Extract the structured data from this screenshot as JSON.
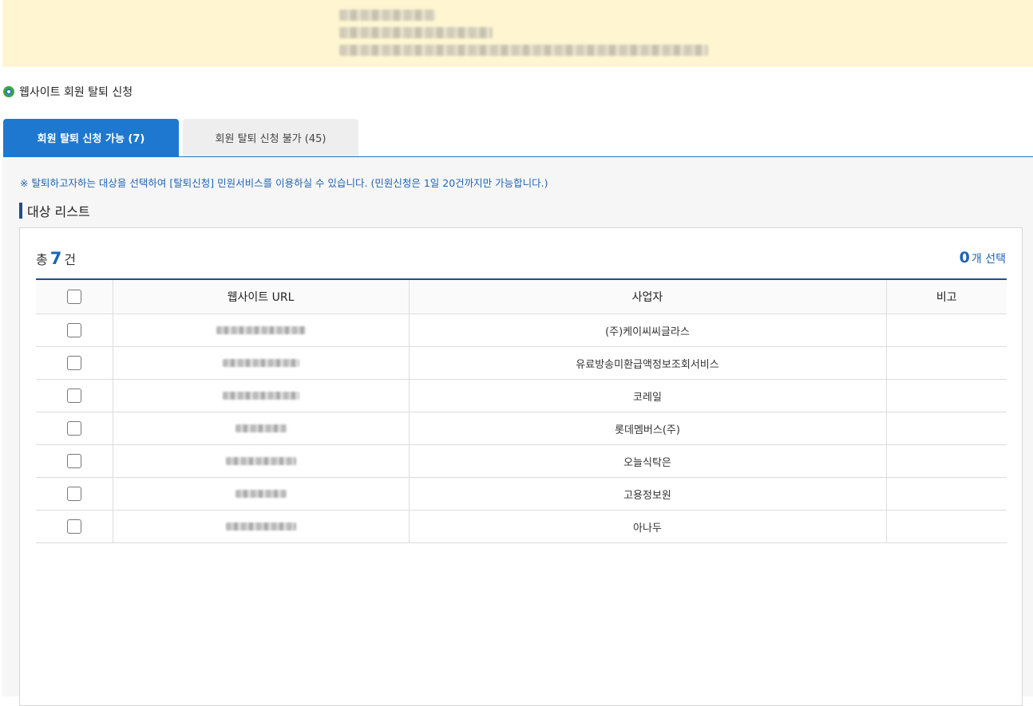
{
  "section_title": "웹사이트 회원 탈퇴 신청",
  "tabs": [
    {
      "label": "회원 탈퇴 신청 가능 (7)",
      "active": true
    },
    {
      "label": "회원 탈퇴 신청 불가 (45)",
      "active": false
    }
  ],
  "notice": "※ 탈퇴하고자하는 대상을 선택하여 [탈퇴신청] 민원서비스를 이용하실 수 있습니다. (민원신청은 1일 20건까지만 가능합니다.)",
  "list_title": "대상 리스트",
  "summary": {
    "total_prefix": "총",
    "total_count": "7",
    "total_suffix": "건",
    "selected_count": "0",
    "selected_suffix": "개 선택"
  },
  "table": {
    "headers": [
      "웹사이트 URL",
      "사업자",
      "비고"
    ],
    "rows": [
      {
        "business": "(주)케이씨씨글라스",
        "note": ""
      },
      {
        "business": "유료방송미환급액정보조회서비스",
        "note": ""
      },
      {
        "business": "코레일",
        "note": ""
      },
      {
        "business": "롯데멤버스(주)",
        "note": ""
      },
      {
        "business": "오늘식탁은",
        "note": ""
      },
      {
        "business": "고용정보원",
        "note": ""
      },
      {
        "business": "아나두",
        "note": ""
      }
    ]
  },
  "colors": {
    "accent": "#1e78d0",
    "dark_accent": "#1f4e8c",
    "banner": "#fff6d1"
  }
}
